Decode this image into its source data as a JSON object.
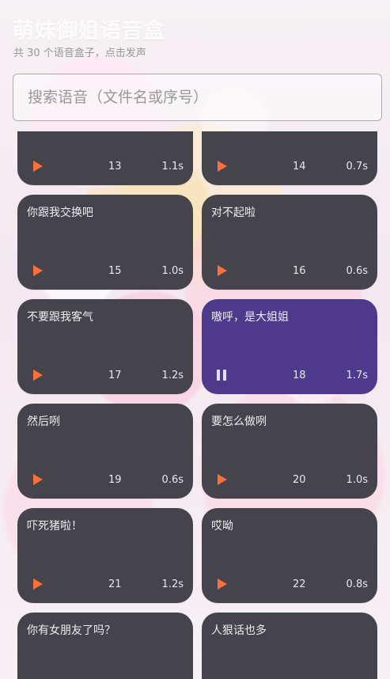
{
  "header": {
    "title": "萌妹御姐语音盒",
    "subtitle": "共 30 个语音盒子，点击发声"
  },
  "search": {
    "placeholder": "搜索语音（文件名或序号）",
    "value": ""
  },
  "items": [
    {
      "name": "",
      "index": "13",
      "duration": "1.1s",
      "state": "play"
    },
    {
      "name": "",
      "index": "14",
      "duration": "0.7s",
      "state": "play"
    },
    {
      "name": "你跟我交换吧",
      "index": "15",
      "duration": "1.0s",
      "state": "play"
    },
    {
      "name": "对不起啦",
      "index": "16",
      "duration": "0.6s",
      "state": "play"
    },
    {
      "name": "不要跟我客气",
      "index": "17",
      "duration": "1.2s",
      "state": "play"
    },
    {
      "name": "嗷呼，是大姐姐",
      "index": "18",
      "duration": "1.7s",
      "state": "pause"
    },
    {
      "name": "然后咧",
      "index": "19",
      "duration": "0.6s",
      "state": "play"
    },
    {
      "name": "要怎么做咧",
      "index": "20",
      "duration": "1.0s",
      "state": "play"
    },
    {
      "name": "吓死猪啦！",
      "index": "21",
      "duration": "1.2s",
      "state": "play"
    },
    {
      "name": "哎呦",
      "index": "22",
      "duration": "0.8s",
      "state": "play"
    },
    {
      "name": "你有女朋友了吗？",
      "index": "",
      "duration": "",
      "state": "play"
    },
    {
      "name": "人狠话也多",
      "index": "",
      "duration": "",
      "state": "play"
    }
  ],
  "colors": {
    "card_bg": "#45434c",
    "card_playing_bg": "#4d3a8d",
    "play_icon": "#ff6f3a",
    "pause_icon": "#ffffff"
  },
  "icons": {
    "play": "play-icon",
    "pause": "pause-icon"
  }
}
